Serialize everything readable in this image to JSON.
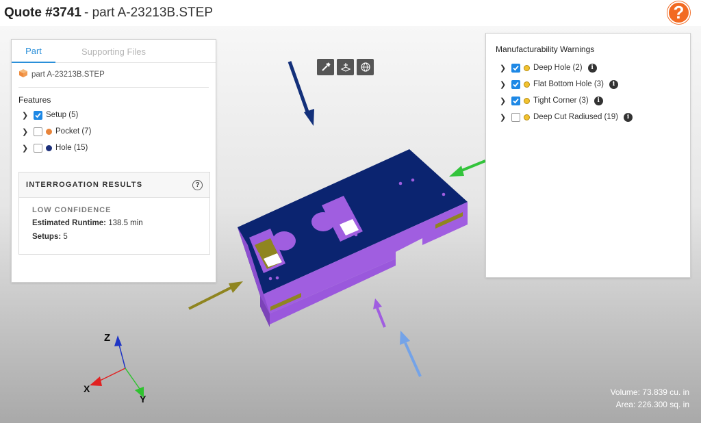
{
  "header": {
    "quote_id": "Quote #3741",
    "separator_file": "- part A-23213B.STEP",
    "help_label": "?"
  },
  "left_panel": {
    "tabs": [
      {
        "label": "Part",
        "active": true
      },
      {
        "label": "Supporting Files",
        "active": false
      }
    ],
    "file_name": "part A-23213B.STEP",
    "features_heading": "Features",
    "features": [
      {
        "label": "Setup (5)",
        "checked": true,
        "dot_color": null
      },
      {
        "label": "Pocket (7)",
        "checked": false,
        "dot_color": "#e8843a"
      },
      {
        "label": "Hole (15)",
        "checked": false,
        "dot_color": "#1c2f7a"
      }
    ],
    "interrogation": {
      "title": "INTERROGATION RESULTS",
      "confidence": "LOW CONFIDENCE",
      "runtime_label": "Estimated Runtime:",
      "runtime_value": "138.5 min",
      "setups_label": "Setups:",
      "setups_value": "5"
    }
  },
  "right_panel": {
    "title": "Manufacturability Warnings",
    "warnings": [
      {
        "label": "Deep Hole (2)",
        "checked": true,
        "dot_color": "#f2c230"
      },
      {
        "label": "Flat Bottom Hole (3)",
        "checked": true,
        "dot_color": "#f2c230"
      },
      {
        "label": "Tight Corner (3)",
        "checked": true,
        "dot_color": "#f2c230"
      },
      {
        "label": "Deep Cut Radiused (19)",
        "checked": false,
        "dot_color": "#f2c230"
      }
    ]
  },
  "view_toolbar": [
    "wrench-hammer-icon",
    "assembly-icon",
    "globe-icon"
  ],
  "axes": {
    "z": "Z",
    "x": "X",
    "y": "Y"
  },
  "stats": {
    "volume": "Volume: 73.839 cu. in",
    "area": "Area: 226.300 sq. in"
  },
  "colors": {
    "accent": "#2a8fd9",
    "help": "#f26a22",
    "part_top": "#0b2470",
    "part_side": "#a05ee0",
    "arrow_navy": "#13307a",
    "arrow_green": "#33c43b",
    "arrow_olive": "#8f8520",
    "arrow_purple": "#a05ee0",
    "arrow_lightblue": "#74a3e8"
  }
}
